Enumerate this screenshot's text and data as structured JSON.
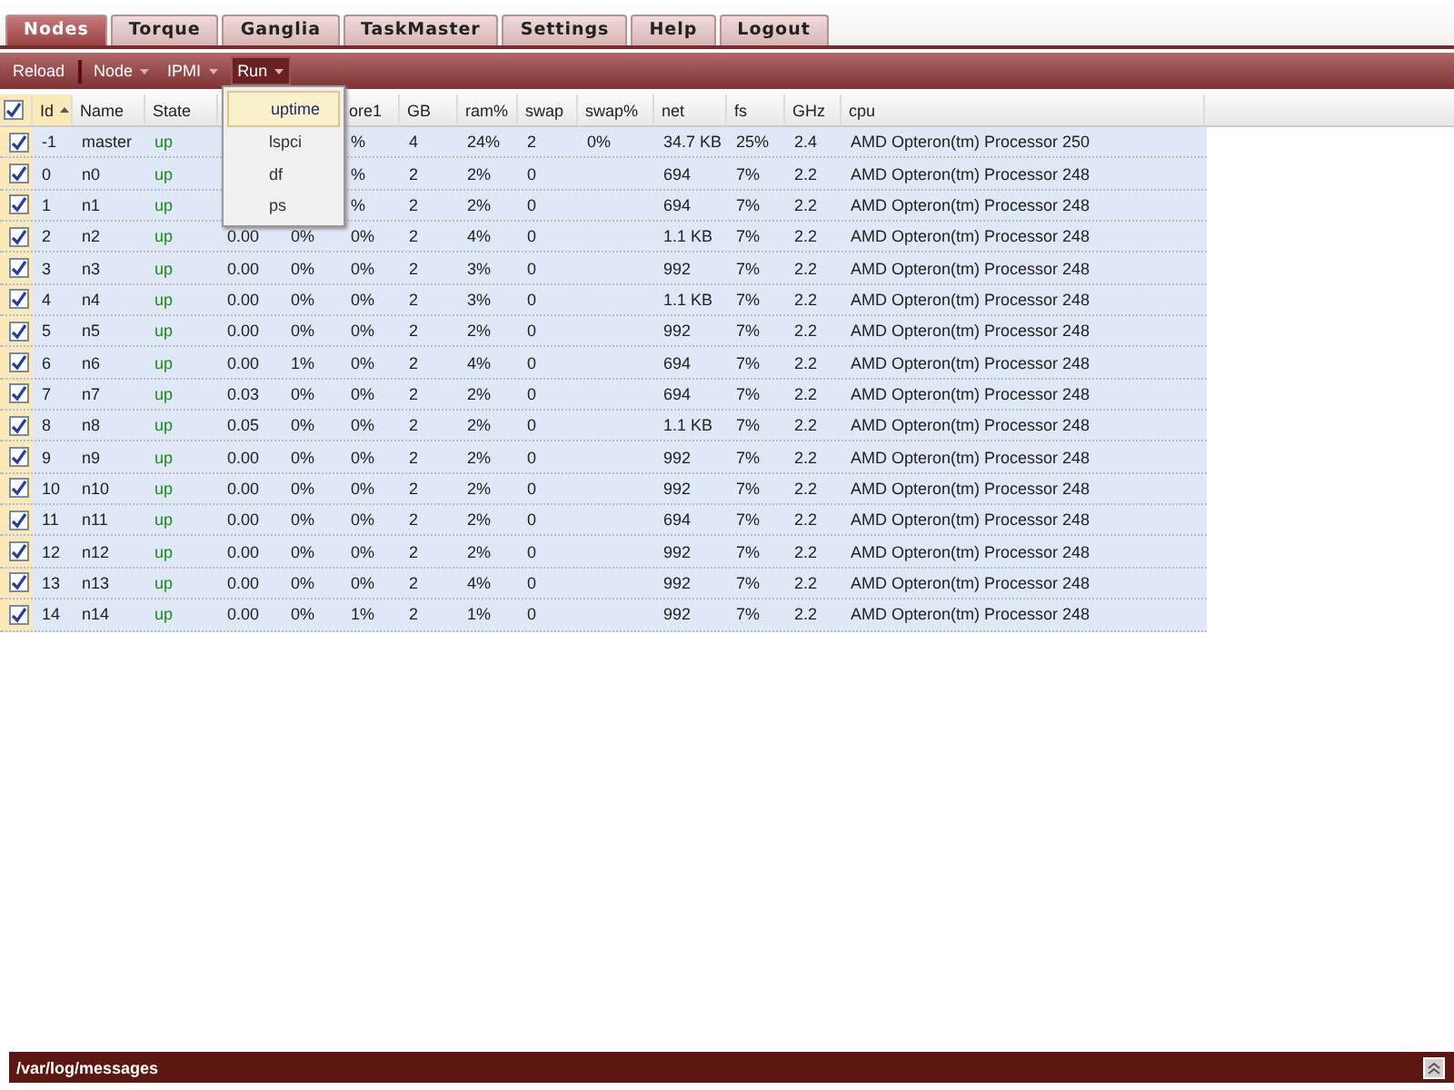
{
  "tabs": [
    {
      "label": "Nodes",
      "selected": true
    },
    {
      "label": "Torque",
      "selected": false
    },
    {
      "label": "Ganglia",
      "selected": false
    },
    {
      "label": "TaskMaster",
      "selected": false
    },
    {
      "label": "Settings",
      "selected": false
    },
    {
      "label": "Help",
      "selected": false
    },
    {
      "label": "Logout",
      "selected": false
    }
  ],
  "toolbar": [
    {
      "label": "Reload",
      "kind": "button",
      "pressed": false
    },
    {
      "label": "Node",
      "kind": "menu",
      "pressed": false
    },
    {
      "label": "IPMI",
      "kind": "menu",
      "pressed": false
    },
    {
      "label": "Run",
      "kind": "menu",
      "pressed": true
    }
  ],
  "run_menu": [
    {
      "label": "uptime",
      "selected": true
    },
    {
      "label": "lspci",
      "selected": false
    },
    {
      "label": "df",
      "selected": false
    },
    {
      "label": "ps",
      "selected": false
    }
  ],
  "table": {
    "all_checked": true,
    "columns": [
      {
        "label": "Id",
        "sorted": true,
        "kind": "text"
      },
      {
        "label": "Name",
        "kind": "text"
      },
      {
        "label": "State",
        "kind": "state"
      },
      {
        "kind": "text"
      },
      {
        "kind": "text"
      },
      {
        "label": "ore1",
        "kind": "text"
      },
      {
        "label": "GB",
        "kind": "text"
      },
      {
        "label": "ram%",
        "kind": "text"
      },
      {
        "label": "swap",
        "kind": "text"
      },
      {
        "label": "swap%",
        "kind": "text"
      },
      {
        "label": "net",
        "kind": "text"
      },
      {
        "label": "fs",
        "kind": "text"
      },
      {
        "label": "GHz",
        "kind": "text"
      },
      {
        "label": "cpu",
        "kind": "text"
      }
    ],
    "rows": [
      {
        "checked": true,
        "cells": [
          "-1",
          "master",
          "up",
          null,
          null,
          "%",
          "4",
          "24%",
          "2",
          "0%",
          "34.7 KB",
          "25%",
          "2.4",
          "AMD Opteron(tm) Processor 250"
        ]
      },
      {
        "checked": true,
        "cells": [
          "0",
          "n0",
          "up",
          null,
          null,
          "%",
          "2",
          "2%",
          "0",
          null,
          "694",
          "7%",
          "2.2",
          "AMD Opteron(tm) Processor 248"
        ]
      },
      {
        "checked": true,
        "cells": [
          "1",
          "n1",
          "up",
          null,
          null,
          "%",
          "2",
          "2%",
          "0",
          null,
          "694",
          "7%",
          "2.2",
          "AMD Opteron(tm) Processor 248"
        ]
      },
      {
        "checked": true,
        "cells": [
          "2",
          "n2",
          "up",
          "0.00",
          "0%",
          "0%",
          "2",
          "4%",
          "0",
          null,
          "1.1 KB",
          "7%",
          "2.2",
          "AMD Opteron(tm) Processor 248"
        ]
      },
      {
        "checked": true,
        "cells": [
          "3",
          "n3",
          "up",
          "0.00",
          "0%",
          "0%",
          "2",
          "3%",
          "0",
          null,
          "992",
          "7%",
          "2.2",
          "AMD Opteron(tm) Processor 248"
        ]
      },
      {
        "checked": true,
        "cells": [
          "4",
          "n4",
          "up",
          "0.00",
          "0%",
          "0%",
          "2",
          "3%",
          "0",
          null,
          "1.1 KB",
          "7%",
          "2.2",
          "AMD Opteron(tm) Processor 248"
        ]
      },
      {
        "checked": true,
        "cells": [
          "5",
          "n5",
          "up",
          "0.00",
          "0%",
          "0%",
          "2",
          "2%",
          "0",
          null,
          "992",
          "7%",
          "2.2",
          "AMD Opteron(tm) Processor 248"
        ]
      },
      {
        "checked": true,
        "cells": [
          "6",
          "n6",
          "up",
          "0.00",
          "1%",
          "0%",
          "2",
          "4%",
          "0",
          null,
          "694",
          "7%",
          "2.2",
          "AMD Opteron(tm) Processor 248"
        ]
      },
      {
        "checked": true,
        "cells": [
          "7",
          "n7",
          "up",
          "0.03",
          "0%",
          "0%",
          "2",
          "2%",
          "0",
          null,
          "694",
          "7%",
          "2.2",
          "AMD Opteron(tm) Processor 248"
        ]
      },
      {
        "checked": true,
        "cells": [
          "8",
          "n8",
          "up",
          "0.05",
          "0%",
          "0%",
          "2",
          "2%",
          "0",
          null,
          "1.1 KB",
          "7%",
          "2.2",
          "AMD Opteron(tm) Processor 248"
        ]
      },
      {
        "checked": true,
        "cells": [
          "9",
          "n9",
          "up",
          "0.00",
          "0%",
          "0%",
          "2",
          "2%",
          "0",
          null,
          "992",
          "7%",
          "2.2",
          "AMD Opteron(tm) Processor 248"
        ]
      },
      {
        "checked": true,
        "cells": [
          "10",
          "n10",
          "up",
          "0.00",
          "0%",
          "0%",
          "2",
          "2%",
          "0",
          null,
          "992",
          "7%",
          "2.2",
          "AMD Opteron(tm) Processor 248"
        ]
      },
      {
        "checked": true,
        "cells": [
          "11",
          "n11",
          "up",
          "0.00",
          "0%",
          "0%",
          "2",
          "2%",
          "0",
          null,
          "694",
          "7%",
          "2.2",
          "AMD Opteron(tm) Processor 248"
        ]
      },
      {
        "checked": true,
        "cells": [
          "12",
          "n12",
          "up",
          "0.00",
          "0%",
          "0%",
          "2",
          "2%",
          "0",
          null,
          "992",
          "7%",
          "2.2",
          "AMD Opteron(tm) Processor 248"
        ]
      },
      {
        "checked": true,
        "cells": [
          "13",
          "n13",
          "up",
          "0.00",
          "0%",
          "0%",
          "2",
          "4%",
          "0",
          null,
          "992",
          "7%",
          "2.2",
          "AMD Opteron(tm) Processor 248"
        ]
      },
      {
        "checked": true,
        "cells": [
          "14",
          "n14",
          "up",
          "0.00",
          "0%",
          "1%",
          "2",
          "1%",
          "0",
          null,
          "992",
          "7%",
          "2.2",
          "AMD Opteron(tm) Processor 248"
        ]
      }
    ]
  },
  "log_panel": {
    "title": "/var/log/messages"
  }
}
